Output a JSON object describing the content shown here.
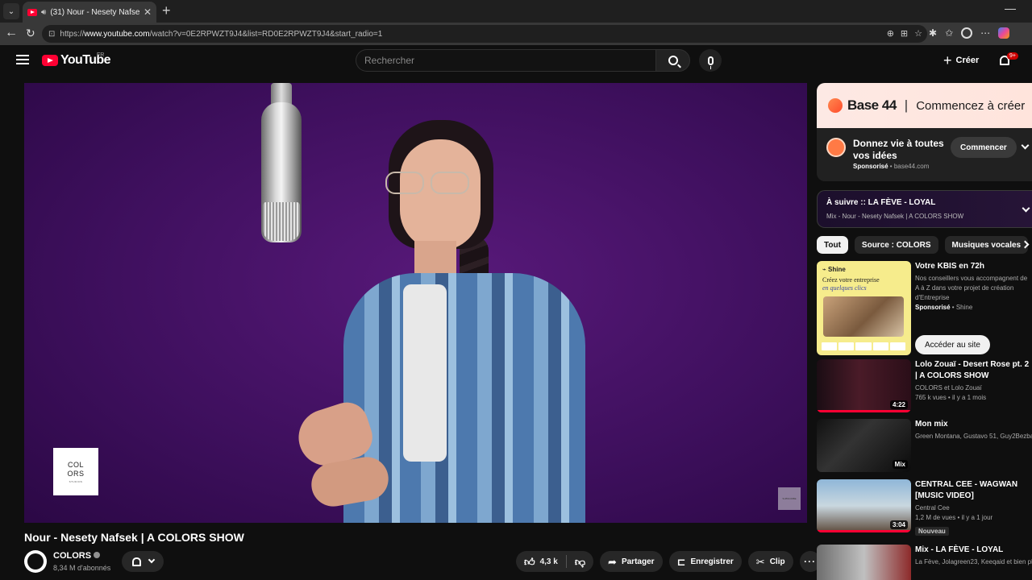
{
  "browser": {
    "tab_title": "(31) Nour - Nesety Nafsek | A COLORS SHOW",
    "url_prefix": "https://",
    "url_host": "www.youtube.com",
    "url_path": "/watch?v=0E2RPWZT9J4&list=RD0E2RPWZT9J4&start_radio=1"
  },
  "header": {
    "logo_text": "YouTube",
    "region": "FR",
    "search_placeholder": "Rechercher",
    "create_label": "Créer",
    "notifications": "9+"
  },
  "player": {
    "logo_line1": "COL",
    "logo_line2": "ORS",
    "logo_sub": "STUDIOS",
    "watermark": "SUBSCRIBE"
  },
  "video": {
    "title": "Nour - Nesety Nafsek | A COLORS SHOW",
    "channel": "COLORS",
    "subscribers": "8,34 M d'abonnés",
    "likes": "4,3 k",
    "share": "Partager",
    "save": "Enregistrer",
    "clip": "Clip"
  },
  "ad": {
    "brand": "Base 44",
    "slogan": "Commencez à créer",
    "headline": "Donnez vie à toutes vos idées",
    "sponsored": "Sponsorisé",
    "domain": "base44.com",
    "cta": "Commencer"
  },
  "upnext": {
    "title": "À suivre :: LA FÈVE - LOYAL",
    "subtitle": "Mix - Nour - Nesety Nafsek | A COLORS SHOW"
  },
  "chips": [
    "Tout",
    "Source : COLORS",
    "Musiques vocales"
  ],
  "sponsored_rec": {
    "thumb_brand": "Shine",
    "thumb_slogan_1": "Créez votre entreprise",
    "thumb_slogan_2": "en quelques clics",
    "title": "Votre KBIS en 72h",
    "description": "Nos conseillers vous accompagnent de A à Z dans votre projet de création d'Entreprise",
    "sponsored": "Sponsorisé",
    "advertiser": "Shine",
    "cta": "Accéder au site"
  },
  "recommendations": [
    {
      "title": "Lolo Zouaï - Desert Rose pt. 2 | A COLORS SHOW",
      "meta": "COLORS et Lolo Zouaï",
      "meta2": "765 k vues • il y a 1 mois",
      "duration": "4:22",
      "progress": 1.0,
      "badge": ""
    },
    {
      "title": "Mon mix",
      "meta": "Green Montana, Gustavo 51, Guy2Bezbar",
      "meta2": "",
      "duration": "Mix",
      "progress": 0,
      "badge": ""
    },
    {
      "title": "CENTRAL CEE - WAGWAN [MUSIC VIDEO]",
      "meta": "Central Cee",
      "meta2": "1,2 M de vues • il y a 1 jour",
      "duration": "3:04",
      "progress": 1.0,
      "badge": "Nouveau"
    },
    {
      "title": "Mix - LA FÈVE - LOYAL",
      "meta": "La Fève, Jolagreen23, Keeqaid et bien plus",
      "meta2": "",
      "duration": "",
      "progress": 0,
      "badge": ""
    }
  ],
  "colors": {
    "youtube_red": "#ff0033",
    "player_purple": "#3d0f5c",
    "background": "#0f0f0f"
  }
}
